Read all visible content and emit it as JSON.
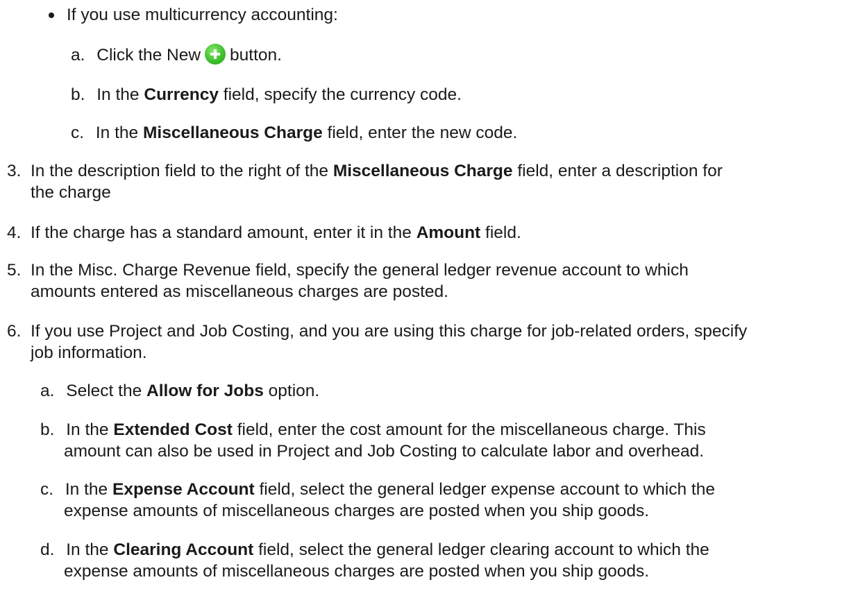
{
  "bullet": {
    "text": "If you use multicurrency accounting:",
    "steps": [
      {
        "marker": "a.",
        "pre": "Click the New",
        "post": "button.",
        "icon": "add-circle-green-icon"
      },
      {
        "marker": "b.",
        "pre": "In the",
        "bold": "Currency",
        "post": "field, specify the currency code."
      },
      {
        "marker": "c.",
        "pre": "In the",
        "bold": "Miscellaneous Charge",
        "post": "field, enter the new code."
      }
    ]
  },
  "step3": {
    "num": "3.",
    "pre": "In the description field to the right of the",
    "bold": "Miscellaneous Charge",
    "post": "field, enter a description for",
    "line2": "the charge"
  },
  "step4": {
    "num": "4.",
    "pre": "If the charge has a standard amount, enter it in the",
    "bold": "Amount",
    "post": "field."
  },
  "step5": {
    "num": "5.",
    "line1": "In the Misc. Charge Revenue field, specify the general ledger revenue account to which",
    "line2": "amounts entered as miscellaneous charges are posted."
  },
  "step6": {
    "num": "6.",
    "line1": "If you use Project and Job Costing, and you are using this charge for job-related orders, specify",
    "line2": "job information.",
    "substeps": [
      {
        "marker": "a.",
        "pre": "Select the",
        "bold": "Allow for Jobs",
        "post": "option."
      },
      {
        "marker": "b.",
        "pre": "In the",
        "bold": "Extended Cost",
        "post": "field, enter the cost amount for the miscellaneous charge. This",
        "line2": "amount can also be used in Project and Job Costing to calculate labor and overhead."
      },
      {
        "marker": "c.",
        "pre": "In the",
        "bold": "Expense Account",
        "post": "field, select the general ledger expense account to which the",
        "line2": "expense amounts of miscellaneous charges are posted when you ship goods."
      },
      {
        "marker": "d.",
        "pre": "In the",
        "bold": "Clearing Account",
        "post": "field, select the general ledger clearing account to which the",
        "line2": "expense amounts of miscellaneous charges are posted when you ship goods."
      }
    ]
  }
}
